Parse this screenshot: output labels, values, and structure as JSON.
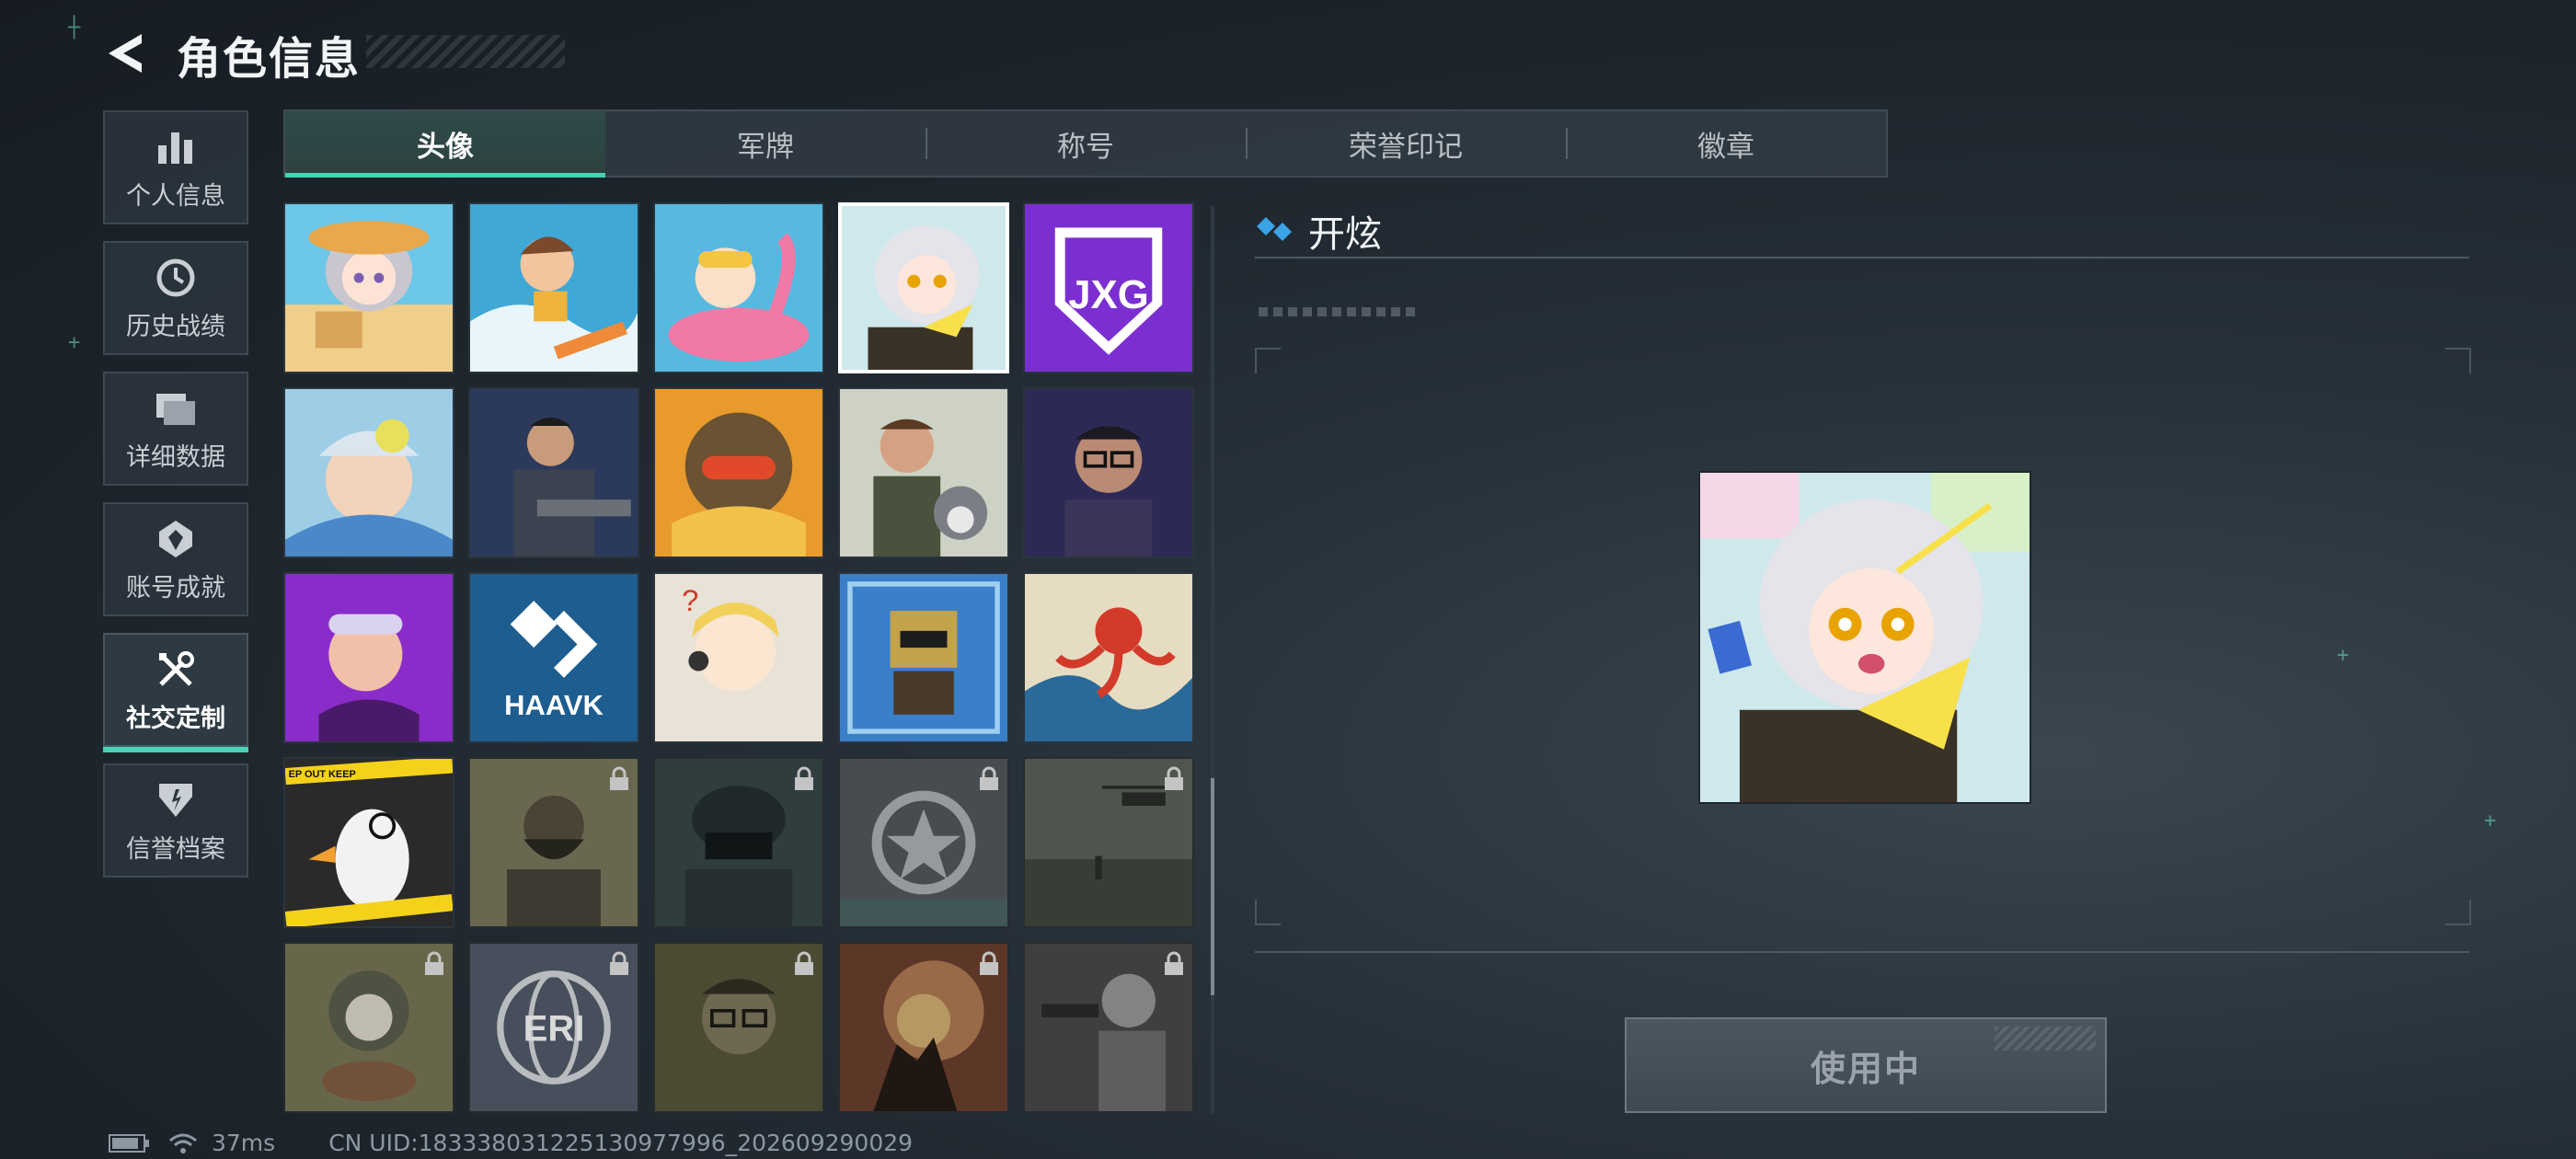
{
  "header": {
    "title": "角色信息"
  },
  "sidebar": {
    "items": [
      {
        "label": "个人信息",
        "icon": "bar-chart-icon"
      },
      {
        "label": "历史战绩",
        "icon": "clock-history-icon"
      },
      {
        "label": "详细数据",
        "icon": "folders-icon"
      },
      {
        "label": "账号成就",
        "icon": "achievement-badge-icon"
      },
      {
        "label": "社交定制",
        "icon": "wrench-screwdriver-icon",
        "active": true
      },
      {
        "label": "信誉档案",
        "icon": "credit-shield-icon"
      }
    ]
  },
  "tabs": [
    {
      "label": "头像",
      "active": true
    },
    {
      "label": "军牌"
    },
    {
      "label": "称号"
    },
    {
      "label": "荣誉印记"
    },
    {
      "label": "徽章"
    }
  ],
  "avatars": [
    {
      "name": "chibi-girl-sandcastle"
    },
    {
      "name": "surfer-boy"
    },
    {
      "name": "kid-flamingo-float"
    },
    {
      "name": "chibi-girl-crate",
      "selected": true
    },
    {
      "name": "jxg-team-logo",
      "text": "JXG"
    },
    {
      "name": "woman-with-bird"
    },
    {
      "name": "soldier-with-rifle"
    },
    {
      "name": "tribal-mask-warrior"
    },
    {
      "name": "man-with-husky"
    },
    {
      "name": "man-with-glasses"
    },
    {
      "name": "woman-purple-goggles"
    },
    {
      "name": "haavk-team-logo",
      "text": "HAAVK"
    },
    {
      "name": "blond-chibi-headset"
    },
    {
      "name": "robot-trophy"
    },
    {
      "name": "red-octopus-wave"
    },
    {
      "name": "goose-with-monocle",
      "tape_text": "EP OUT   KEEP"
    },
    {
      "name": "bearded-operator",
      "locked": true
    },
    {
      "name": "helmeted-soldier",
      "locked": true
    },
    {
      "name": "star-emblem",
      "locked": true
    },
    {
      "name": "helicopter-field",
      "locked": true
    },
    {
      "name": "armored-cat-eating",
      "locked": true
    },
    {
      "name": "eri-globe-logo",
      "locked": true,
      "text": "ERI"
    },
    {
      "name": "man-glasses-portrait",
      "locked": true
    },
    {
      "name": "explosion-silhouette",
      "locked": true
    },
    {
      "name": "soldier-aiming-pistol",
      "locked": true
    }
  ],
  "detail": {
    "title": "开炫",
    "button_label": "使用中"
  },
  "status_bar": {
    "ping": "37ms",
    "uid": "CN UID:18333803122513097799​6_202609290029"
  },
  "colors": {
    "accent": "#45d3b2",
    "title_diamond": "#3ba3e8"
  }
}
